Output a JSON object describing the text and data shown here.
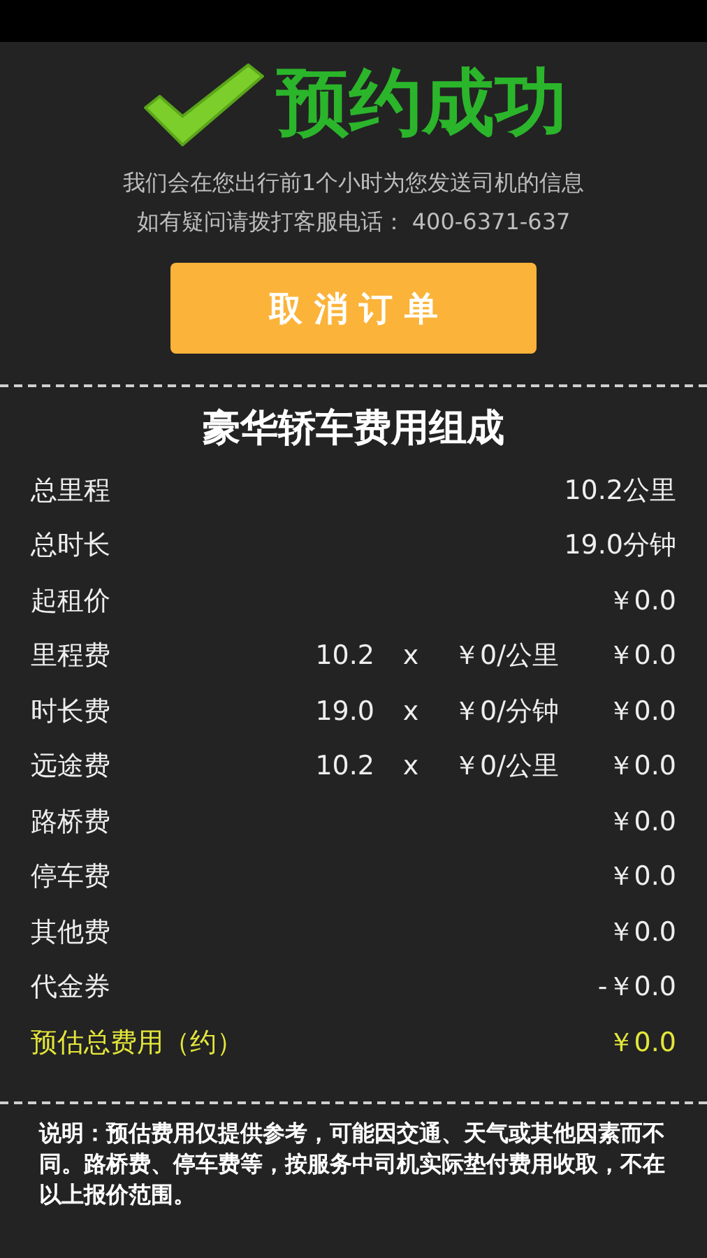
{
  "success": {
    "title": "预约成功",
    "messages": [
      "我们会在您出行前1个小时为您发送司机的信息",
      "如有疑问请拨打客服电话： 400-6371-637"
    ],
    "cancel_button": "取 消 订 单"
  },
  "fees": {
    "title": "豪华轿车费用组成",
    "rows": [
      {
        "kind": "plain",
        "label": "总里程",
        "amount": "10.2公里"
      },
      {
        "kind": "plain",
        "label": "总时长",
        "amount": "19.0分钟"
      },
      {
        "kind": "plain",
        "label": "起租价",
        "amount": "￥0.0"
      },
      {
        "kind": "calc",
        "label": "里程费",
        "quantity": "10.2",
        "times": "x",
        "unit_price": "￥0/公里",
        "amount": "￥0.0"
      },
      {
        "kind": "calc",
        "label": "时长费",
        "quantity": "19.0",
        "times": "x",
        "unit_price": "￥0/分钟",
        "amount": "￥0.0"
      },
      {
        "kind": "calc",
        "label": "远途费",
        "quantity": "10.2",
        "times": "x",
        "unit_price": "￥0/公里",
        "amount": "￥0.0"
      },
      {
        "kind": "plain",
        "label": "路桥费",
        "amount": "￥0.0"
      },
      {
        "kind": "plain",
        "label": "停车费",
        "amount": "￥0.0"
      },
      {
        "kind": "plain",
        "label": "其他费",
        "amount": "￥0.0"
      },
      {
        "kind": "plain",
        "label": "代金券",
        "amount": "-￥0.0"
      },
      {
        "kind": "total",
        "label": "预估总费用（约）",
        "amount": "￥0.0"
      }
    ],
    "note": "说明：预估费用仅提供参考，可能因交通、天气或其他因素而不同。路桥费、停车费等，按服务中司机实际垫付费用收取，不在以上报价范围。"
  }
}
